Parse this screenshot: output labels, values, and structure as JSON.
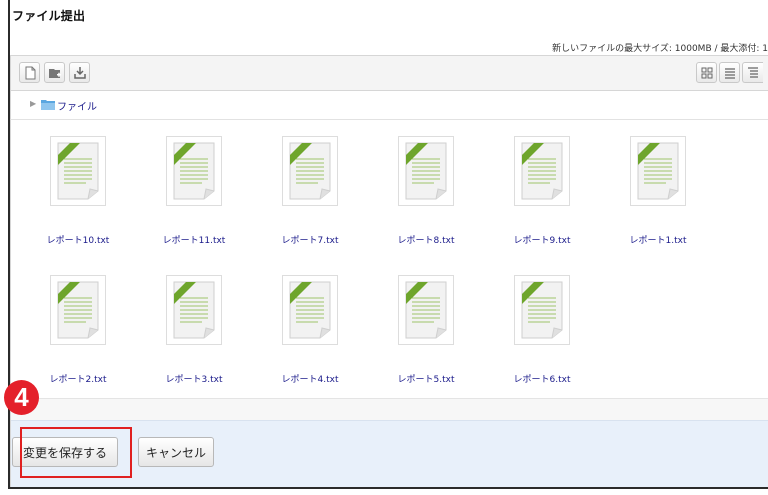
{
  "section": {
    "title": "ファイル提出",
    "max_size_text": "新しいファイルの最大サイズ: 1000MB / 最大添付: 1"
  },
  "toolbar": {
    "left_icons": [
      "add-file-icon",
      "create-folder-icon",
      "download-icon"
    ],
    "right_icons": [
      "icon-view-icon",
      "list-view-icon",
      "tree-view-icon"
    ]
  },
  "path": {
    "label": "ファイル"
  },
  "files": [
    {
      "name": "レポート10.txt"
    },
    {
      "name": "レポート11.txt"
    },
    {
      "name": "レポート7.txt"
    },
    {
      "name": "レポート8.txt"
    },
    {
      "name": "レポート9.txt"
    },
    {
      "name": "レポート1.txt"
    },
    {
      "name": "レポート2.txt"
    },
    {
      "name": "レポート3.txt"
    },
    {
      "name": "レポート4.txt"
    },
    {
      "name": "レポート5.txt"
    },
    {
      "name": "レポート6.txt"
    }
  ],
  "buttons": {
    "save_label": "変更を保存する",
    "cancel_label": "キャンセル"
  },
  "annotation": {
    "step_number": "4",
    "badge_color": "#e4202a",
    "highlight_color": "#e02020"
  }
}
